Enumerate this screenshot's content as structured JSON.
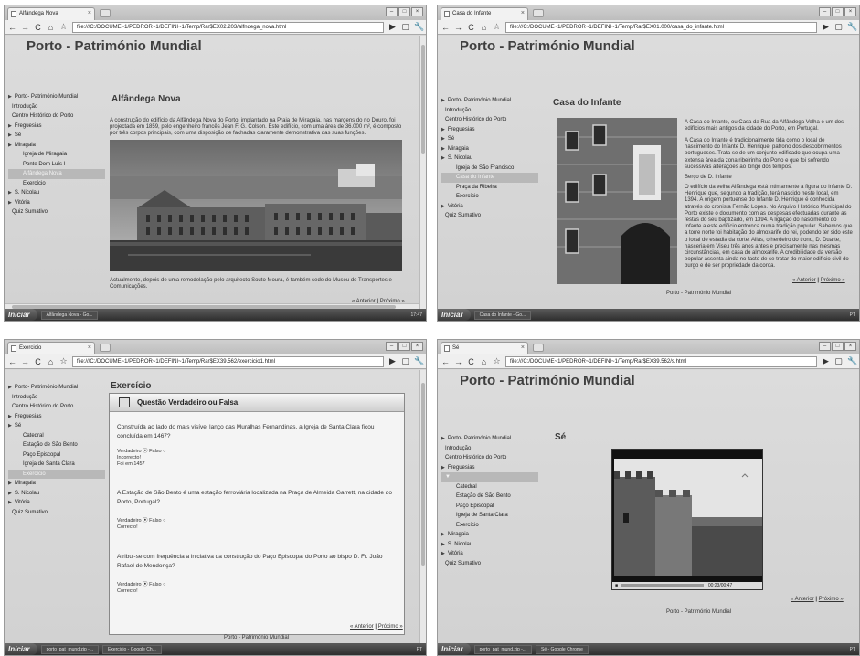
{
  "quadrants": [
    {
      "tab_title": "Alfândega Nova",
      "url": "file:///C:/DOCUME~1/PEDROR~1/DEFINI~1/Temp/Rar$EX02.203/alfndega_nova.html",
      "page_title": "Porto - Património Mundial",
      "menu": [
        "Porto- Património Mundial",
        "Introdução",
        "Centro Histórico do Porto",
        "Freguesias",
        "Sé",
        "Miragaia",
        "Igreja de Miragaia",
        "Ponte Dom Luís I",
        "Alfândega Nova",
        "Exercício",
        "S. Nicolau",
        "Vitória",
        "Quiz Sumativo"
      ],
      "section_title": "Alfândega Nova",
      "paragraph": "A construção do edifício da Alfândega Nova do Porto, implantado na Praia de Miragaia, nas margens do rio Douro, foi projectada em 1859, pelo engenheiro francês Jean F. G. Colson. Este edifício, com uma área de 36.000 m², é composto por três corpos principais, com uma disposição de fachadas claramente demonstrativa das suas funções.",
      "caption": "Actualmente, depois de uma remodelação pelo arquitecto Souto Moura, é também sede do Museu de Transportes e Comunicações.",
      "nav_prev": "« Anterior",
      "nav_sep": "|",
      "nav_next": "Próximo »",
      "start": "Iniciar",
      "tasks": [
        "Alfândega Nova - Go..."
      ],
      "tray": "17:47"
    },
    {
      "tab_title": "Casa do Infante",
      "url": "file:///C:/DOCUME~1/PEDROR~1/DEFINI~1/Temp/Rar$EX01.000/casa_do_infante.html",
      "page_title": "Porto - Património Mundial",
      "menu": [
        "Porto- Património Mundial",
        "Introdução",
        "Centro Histórico do Porto",
        "Freguesias",
        "Sé",
        "Miragaia",
        "S. Nicolau",
        "Igreja de São Francisco",
        "Casa do Infante",
        "Praça da Ribeira",
        "Exercício",
        "Vitória",
        "Quiz Sumativo"
      ],
      "section_title": "Casa do Infante",
      "p1": "A Casa do Infante, ou Casa da Rua da Alfândega Velha é um dos edifícios mais antigos da cidade do Porto, em Portugal.",
      "p2": "A Casa do Infante é tradicionalmente tida como o local de nascimento do Infante D. Henrique, patrono dos descobrimentos portugueses. Trata-se de um conjunto edificado que ocupa uma extensa área da zona ribeirinha do Porto e que foi sofrendo sucessivas alterações ao longo dos tempos.",
      "p3": "Berço de D. Infante",
      "p4": "O edifício da velha Alfândega está intimamente à figura do Infante D. Henrique que, segundo a tradição, terá nascido neste local, em 1394. A origem portuense do Infante D. Henrique é conhecida através do cronista Fernão Lopes. No Arquivo Histórico Municipal do Porto existe o documento com as despesas efectuadas durante as festas do seu baptizado, em 1394. A ligação do nascimento do Infante a este edifício entronca numa tradição popular. Sabemos que a torre norte foi habitação do almoxarife do rei, podendo ter sido este o local de estadia da corte. Aliás, o herdeiro do trono, D. Duarte, nasceria em Viseu três anos antes e precisamente nas mesmas circunstâncias, em casa do almoxarife. A credibilidade da versão popular assenta ainda no facto de se tratar do maior edifício civil do burgo e de ser propriedade da coroa.",
      "nav_prev": "« Anterior",
      "nav_sep": "|",
      "nav_next": "Próximo »",
      "footer": "Porto - Património Mundial",
      "start": "Iniciar",
      "tasks": [
        "Casa do Infante - Go..."
      ],
      "tray": "PT"
    },
    {
      "tab_title": "Exercicio",
      "url": "file:///C:/DOCUME~1/PEDROR~1/DEFINI~1/Temp/Rar$EX39.562/exercicio1.html",
      "menu": [
        "Porto- Património Mundial",
        "Introdução",
        "Centro Histórico do Porto",
        "Freguesias",
        "Sé",
        "Catedral",
        "Estação de São Bento",
        "Paço Episcopal",
        "Igreja de Santa Clara",
        "Exercício",
        "Miragaia",
        "S. Nicolau",
        "Vitória",
        "Quiz Sumativo"
      ],
      "section_title": "Exercício",
      "quiz_title": "Questão Verdadeiro ou Falsa",
      "questions": [
        {
          "text": "Construída ao lado do mais visível lanço das Muralhas Fernandinas, a Igreja de Santa Clara ficou concluída em 1467?",
          "opts": "Verdadeiro ⦿ Falso ○",
          "fb1": "Incorrecto!",
          "fb2": "Foi em 1457"
        },
        {
          "text": "A Estação de São Bento é uma estação ferroviária localizada na Praça de Almeida Garrett, na cidade do Porto, Portugal?",
          "opts": "Verdadeiro ⦿ Falso ○",
          "fb1": "Correcto!",
          "fb2": ""
        },
        {
          "text": "Atribui-se com frequência a iniciativa da construção do Paço Episcopal do Porto ao bispo D. Fr. João Rafael de Mendonça?",
          "opts": "Verdadeiro ⦿ Falso ○",
          "fb1": "Correcto!",
          "fb2": ""
        }
      ],
      "nav_prev": "« Anterior",
      "nav_sep": "|",
      "nav_next": "Próximo »",
      "footer": "Porto - Património Mundial",
      "start": "Iniciar",
      "tasks": [
        "porto_pat_mund.zip -...",
        "Exercicio - Google Ch..."
      ],
      "tray": "PT"
    },
    {
      "tab_title": "Sé",
      "url": "file:///C:/DOCUME~1/PEDROR~1/DEFINI~1/Temp/Rar$EX39.562/s.html",
      "page_title": "Porto - Património Mundial",
      "menu": [
        "Porto- Património Mundial",
        "Introdução",
        "Centro Histórico do Porto",
        "Freguesias",
        "",
        "Catedral",
        "Estação de São Bento",
        "Paço Episcopal",
        "Igreja de Santa Clara",
        "Exercício",
        "Miragaia",
        "S. Nicolau",
        "Vitória",
        "Quiz Sumativo"
      ],
      "section_title": "Sé",
      "video_time": "00:23/00:47",
      "nav_prev": "« Anterior",
      "nav_sep": "|",
      "nav_next": "Próximo »",
      "footer": "Porto - Património Mundial",
      "start": "Iniciar",
      "tasks": [
        "porto_pat_mund.zip -...",
        "Sé - Google Chrome"
      ],
      "tray": "PT"
    }
  ]
}
